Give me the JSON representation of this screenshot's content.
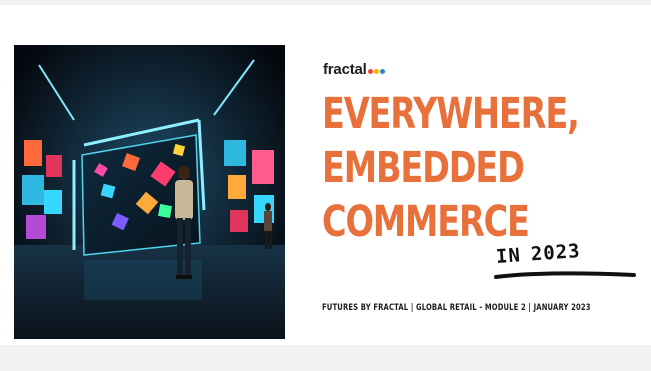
{
  "brand": {
    "logo_text": "fractal",
    "logo_dot_colors": [
      "#e84a3a",
      "#f2b400",
      "#2e86c1"
    ]
  },
  "headline": {
    "line1": "EVERYWHERE,",
    "line2": "EMBEDDED",
    "line3": "COMMERCE"
  },
  "script": {
    "prefix": "IN",
    "year": "2023"
  },
  "tagline": "FUTURES BY FRACTAL | GLOBAL RETAIL - MODULE 2 | JANUARY 2023",
  "colors": {
    "accent": "#e8703a",
    "text": "#1d1d1b"
  }
}
